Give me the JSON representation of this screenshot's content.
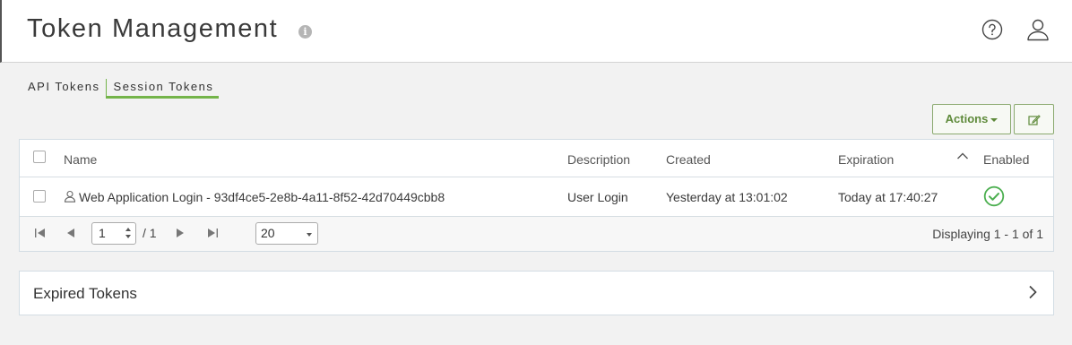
{
  "header": {
    "title": "Token Management",
    "info_icon": "info-icon",
    "help_icon": "help-circle-icon",
    "user_icon": "user-icon"
  },
  "tabs": [
    {
      "label": "API Tokens",
      "active": false
    },
    {
      "label": "Session Tokens",
      "active": true
    }
  ],
  "toolbar": {
    "actions_label": "Actions",
    "edit_icon": "edit-icon"
  },
  "table": {
    "columns": [
      "Name",
      "Description",
      "Created",
      "Expiration",
      "Enabled"
    ],
    "rows": [
      {
        "name": "Web Application Login - 93df4ce5-2e8b-4a11-8f52-42d70449cbb8",
        "description": "User Login",
        "created": "Yesterday at 13:01:02",
        "expiration": "Today at 17:40:27",
        "enabled": true
      }
    ]
  },
  "pager": {
    "page": "1",
    "total_pages": "/ 1",
    "page_size": "20",
    "displaying": "Displaying 1 - 1 of 1"
  },
  "expired": {
    "title": "Expired Tokens"
  },
  "colors": {
    "accent_green": "#74b44a",
    "enabled_green": "#4caf50"
  }
}
